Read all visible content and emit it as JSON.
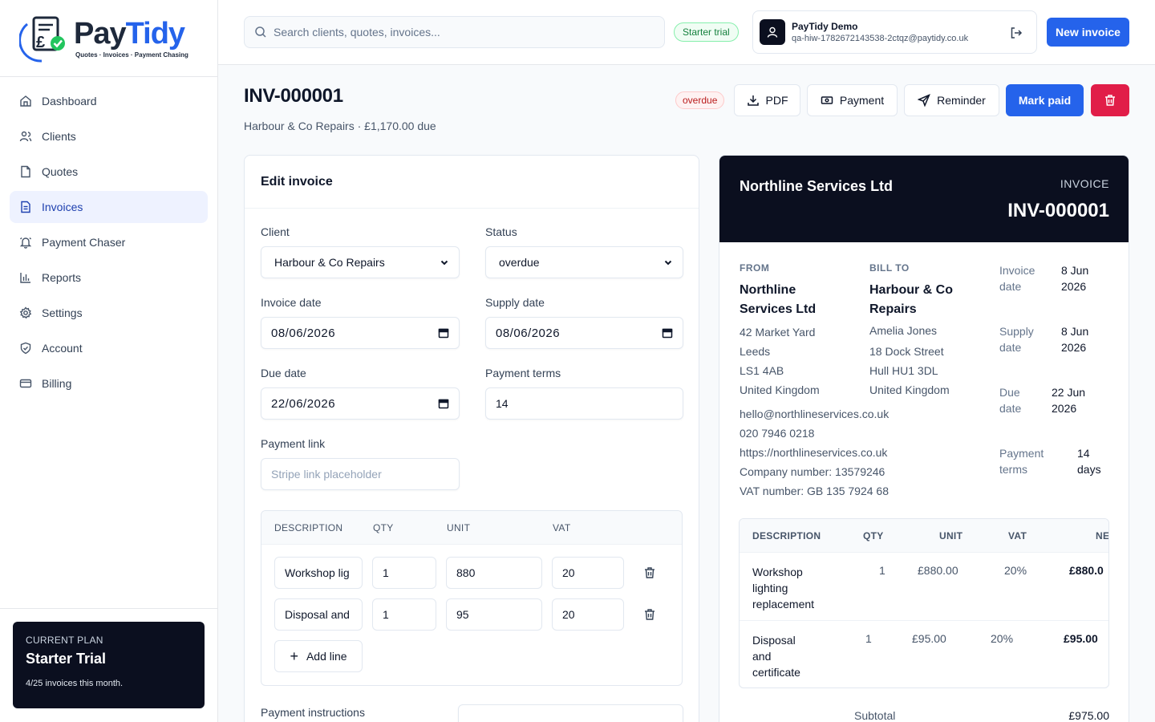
{
  "brand": {
    "name_part1": "Pay",
    "name_part2": "Tidy",
    "tagline": "Quotes · Invoices · Payment Chasing"
  },
  "sidebar": {
    "items": [
      {
        "label": "Dashboard",
        "icon": "home-icon"
      },
      {
        "label": "Clients",
        "icon": "users-icon"
      },
      {
        "label": "Quotes",
        "icon": "document-icon"
      },
      {
        "label": "Invoices",
        "icon": "invoice-icon",
        "active": true
      },
      {
        "label": "Payment Chaser",
        "icon": "bell-icon"
      },
      {
        "label": "Reports",
        "icon": "bar-chart-icon"
      },
      {
        "label": "Settings",
        "icon": "gear-icon"
      },
      {
        "label": "Account",
        "icon": "shield-icon"
      },
      {
        "label": "Billing",
        "icon": "credit-card-icon"
      }
    ],
    "plan": {
      "label": "CURRENT PLAN",
      "name": "Starter Trial",
      "usage": "4/25 invoices this month."
    }
  },
  "header": {
    "search_placeholder": "Search clients, quotes, invoices...",
    "trial_badge": "Starter trial",
    "user_name": "PayTidy Demo",
    "user_email": "qa-hiw-1782672143538-2ctqz@paytidy.co.uk",
    "new_invoice": "New invoice"
  },
  "invoice": {
    "number": "INV-000001",
    "subtitle": "Harbour & Co Repairs · £1,170.00 due",
    "status": "overdue",
    "actions": {
      "pdf": "PDF",
      "payment": "Payment",
      "reminder": "Reminder",
      "mark_paid": "Mark paid"
    }
  },
  "edit": {
    "title": "Edit invoice",
    "client_label": "Client",
    "client_value": "Harbour & Co Repairs",
    "status_label": "Status",
    "status_value": "overdue",
    "invoice_date_label": "Invoice date",
    "invoice_date": "08/06/2026",
    "supply_date_label": "Supply date",
    "supply_date": "08/06/2026",
    "due_date_label": "Due date",
    "due_date": "22/06/2026",
    "terms_label": "Payment terms",
    "terms_value": "14",
    "link_label": "Payment link",
    "link_placeholder": "Stripe link placeholder",
    "lines_headers": {
      "description": "DESCRIPTION",
      "qty": "QTY",
      "unit": "UNIT",
      "vat": "VAT"
    },
    "lines": [
      {
        "description": "Workshop lig",
        "qty": "1",
        "unit": "880",
        "vat": "20"
      },
      {
        "description": "Disposal and",
        "qty": "1",
        "unit": "95",
        "vat": "20"
      }
    ],
    "add_line": "Add line",
    "instructions_label": "Payment instructions"
  },
  "preview": {
    "company": "Northline Services Ltd",
    "kind": "INVOICE",
    "number": "INV-000001",
    "from_label": "FROM",
    "from_name_1": "Northline",
    "from_name_2": "Services Ltd",
    "from_address": [
      "42 Market Yard",
      "Leeds",
      "LS1 4AB",
      "United Kingdom"
    ],
    "contact": [
      "hello@northlineservices.co.uk",
      "020 7946 0218",
      "https://northlineservices.co.uk",
      "Company number: 13579246",
      "VAT number: GB 135 7924 68"
    ],
    "bill_label": "BILL TO",
    "bill_name_1": "Harbour & Co",
    "bill_name_2": "Repairs",
    "bill_address": [
      "Amelia Jones",
      "18 Dock Street",
      "Hull HU1 3DL",
      "United Kingdom"
    ],
    "meta": [
      {
        "l1": "Invoice",
        "l2": "date",
        "v1": "8 Jun",
        "v2": "2026"
      },
      {
        "l1": "Supply",
        "l2": "date",
        "v1": "8 Jun",
        "v2": "2026"
      },
      {
        "l1": "Due",
        "l2": "date",
        "v1": "22 Jun",
        "v2": "2026"
      },
      {
        "l1": "Payment",
        "l2": "terms",
        "v1": "14",
        "v2": "days"
      }
    ],
    "table_headers": {
      "description": "DESCRIPTION",
      "qty": "QTY",
      "unit": "UNIT",
      "vat": "VAT",
      "net": "NE"
    },
    "rows": [
      {
        "d1": "Workshop",
        "d2": "lighting",
        "d3": "replacement",
        "qty": "1",
        "unit": "£880.00",
        "vat": "20%",
        "net": "£880.0"
      },
      {
        "d1": "Disposal",
        "d2": "and",
        "d3": "certificate",
        "qty": "1",
        "unit": "£95.00",
        "vat": "20%",
        "net": "£95.00"
      }
    ],
    "subtotal_label": "Subtotal",
    "subtotal_value": "£975.00"
  }
}
